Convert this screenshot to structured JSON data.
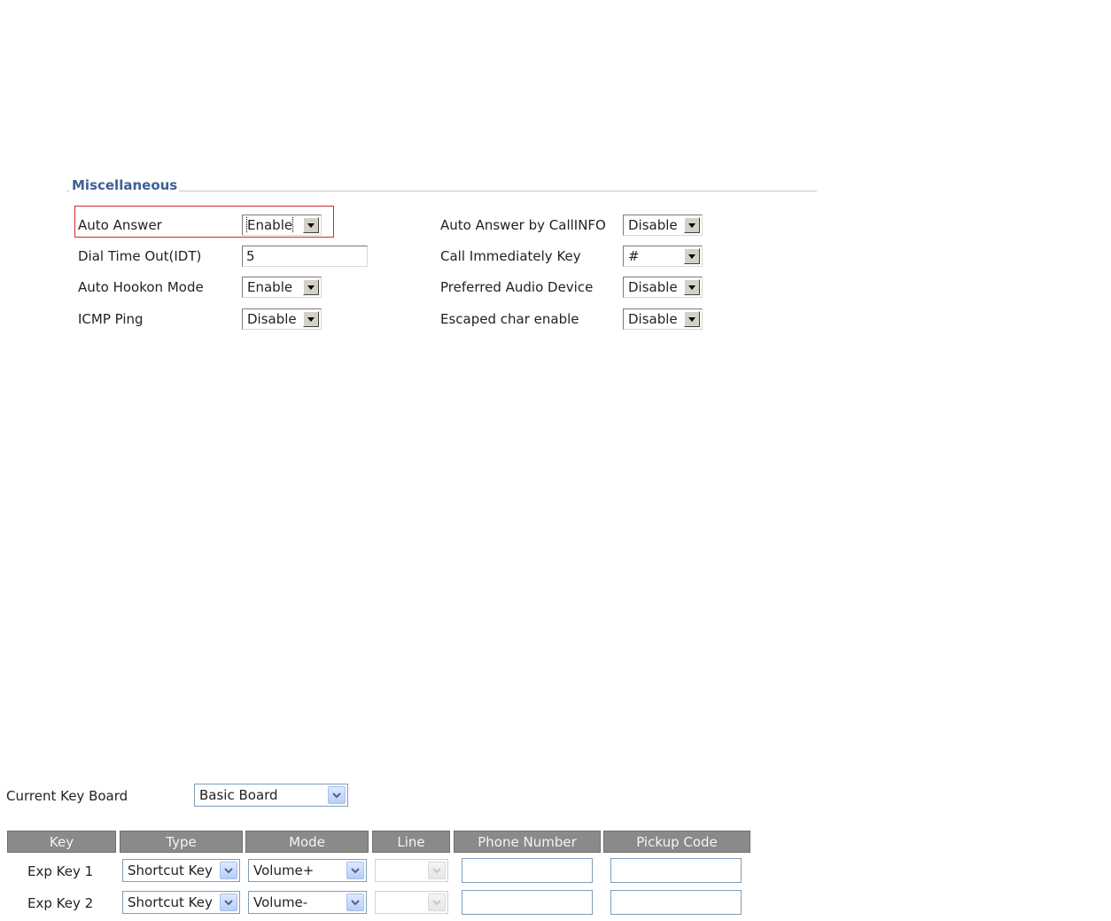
{
  "misc": {
    "title": "Miscellaneous",
    "fields": {
      "auto_answer": {
        "label": "Auto Answer",
        "value": "Enable"
      },
      "dial_timeout": {
        "label": "Dial Time Out(IDT)",
        "value": "5"
      },
      "auto_hookon": {
        "label": "Auto Hookon Mode",
        "value": "Enable"
      },
      "icmp_ping": {
        "label": "ICMP Ping",
        "value": "Disable"
      },
      "auto_answer_callinfo": {
        "label": "Auto Answer by CallINFO",
        "value": "Disable"
      },
      "call_immediately_key": {
        "label": "Call Immediately Key",
        "value": "#"
      },
      "preferred_audio": {
        "label": "Preferred Audio Device",
        "value": "Disable"
      },
      "escaped_char": {
        "label": "Escaped char enable",
        "value": "Disable"
      }
    },
    "highlight_color": "#d12a2a",
    "title_color": "#3e5f95"
  },
  "keyboard": {
    "label": "Current Key Board",
    "value": "Basic Board",
    "headers": [
      "Key",
      "Type",
      "Mode",
      "Line",
      "Phone Number",
      "Pickup Code"
    ],
    "rows": [
      {
        "key": "Exp Key 1",
        "type": "Shortcut Key",
        "mode": "Volume+",
        "line": "",
        "phone": "",
        "pickup": ""
      },
      {
        "key": "Exp Key 2",
        "type": "Shortcut Key",
        "mode": "Volume-",
        "line": "",
        "phone": "",
        "pickup": ""
      }
    ]
  },
  "icons": {
    "classic_dropdown": "chevron-down-icon",
    "xp_dropdown": "chevron-down-icon"
  }
}
